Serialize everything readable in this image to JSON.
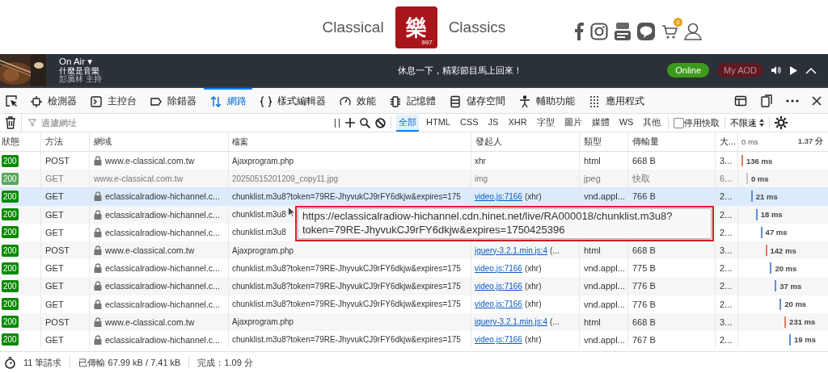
{
  "site_header": {
    "brand_left": "Classical",
    "logo_char": "樂",
    "logo_number": "997",
    "brand_right": "Classics",
    "cart_count": "0"
  },
  "player": {
    "status": "On Air ▾",
    "program": "什麼是音樂",
    "host": "彭廣林 主持",
    "message": "休息一下，精彩節目馬上回來！",
    "online_button": "Online",
    "aod_button": "My AOD"
  },
  "devtools": {
    "tabs": [
      {
        "kind": "inspector",
        "label": "檢測器",
        "selected": false
      },
      {
        "kind": "console",
        "label": "主控台",
        "selected": false
      },
      {
        "kind": "debugger",
        "label": "除錯器",
        "selected": false
      },
      {
        "kind": "network",
        "label": "網路",
        "selected": true
      },
      {
        "kind": "style",
        "label": "樣式編輯器",
        "selected": false
      },
      {
        "kind": "performance",
        "label": "效能",
        "selected": false
      },
      {
        "kind": "memory",
        "label": "記憶體",
        "selected": false
      },
      {
        "kind": "storage",
        "label": "儲存空間",
        "selected": false
      },
      {
        "kind": "accessibility",
        "label": "輔助功能",
        "selected": false
      },
      {
        "kind": "application",
        "label": "應用程式",
        "selected": false
      }
    ]
  },
  "filter": {
    "placeholder": "過濾網址",
    "types": [
      {
        "label": "全部",
        "selected": true
      },
      {
        "label": "HTML",
        "selected": false
      },
      {
        "label": "CSS",
        "selected": false
      },
      {
        "label": "JS",
        "selected": false
      },
      {
        "label": "XHR",
        "selected": false
      },
      {
        "label": "字型",
        "selected": false
      },
      {
        "label": "圖片",
        "selected": false
      },
      {
        "label": "媒體",
        "selected": false
      },
      {
        "label": "WS",
        "selected": false
      },
      {
        "label": "其他",
        "selected": false
      }
    ],
    "disable_cache": {
      "label": "停用快取",
      "checked": false
    },
    "throttle": "不限速"
  },
  "table": {
    "columns": [
      "狀態",
      "方法",
      "網域",
      "檔案",
      "發起人",
      "類型",
      "傳輸量",
      "大..."
    ],
    "timeline_start": "0 ms",
    "timeline_end": "1.37 分",
    "rows": [
      {
        "status": "200",
        "method": "POST",
        "secure": true,
        "cached": false,
        "selected": false,
        "domain": "www.e-classical.com.tw",
        "file": "Ajaxprogram.php",
        "initiator": "xhr",
        "type": "html",
        "transferred": "668 B",
        "size": "3...",
        "duration": "136 ms",
        "color": "#e0815a"
      },
      {
        "status": "200",
        "method": "GET",
        "secure": false,
        "cached": true,
        "selected": false,
        "domain": "www.e-classical.com.tw",
        "file": "20250515201209_copy11.jpg",
        "initiator": "img",
        "type": "jpeg",
        "transferred": "快取",
        "size": "6...",
        "duration": "0 ms",
        "color": "#c8c8c8"
      },
      {
        "status": "200",
        "method": "GET",
        "secure": true,
        "cached": false,
        "selected": true,
        "domain": "eclassicalradiow-hichannel.c...",
        "file": "chunklist.m3u8?token=79RE-JhyvukCJ9rFY6dkjw&expires=175",
        "initiator_link": "video.js:7166",
        "initiator_note": "(xhr)",
        "type": "vnd.appl...",
        "transferred": "766 B",
        "size": "2...",
        "duration": "21 ms",
        "color": "#5b8fd6"
      },
      {
        "status": "200",
        "method": "GET",
        "secure": true,
        "cached": false,
        "selected": false,
        "domain": "eclassicalradiow-hichannel.c...",
        "file": "chunklist.m3u8",
        "size": "2...",
        "duration": "18 ms",
        "color": "#5b8fd6"
      },
      {
        "status": "200",
        "method": "GET",
        "secure": true,
        "cached": false,
        "selected": false,
        "domain": "eclassicalradiow-hichannel.c...",
        "file": "chunklist.m3u8",
        "size": "2...",
        "duration": "47 ms",
        "color": "#5b8fd6"
      },
      {
        "status": "200",
        "method": "POST",
        "secure": true,
        "cached": false,
        "selected": false,
        "domain": "www.e-classical.com.tw",
        "file": "Ajaxprogram.php",
        "initiator_link": "jquery-3.2.1.min.js:4",
        "initiator_note": "(...",
        "type": "html",
        "transferred": "668 B",
        "size": "3...",
        "duration": "142 ms",
        "color": "#e0815a"
      },
      {
        "status": "200",
        "method": "GET",
        "secure": true,
        "cached": false,
        "selected": false,
        "domain": "eclassicalradiow-hichannel.c...",
        "file": "chunklist.m3u8?token=79RE-JhyvukCJ9rFY6dkjw&expires=175",
        "initiator_link": "video.js:7166",
        "initiator_note": "(xhr)",
        "type": "vnd.appl...",
        "transferred": "775 B",
        "size": "2...",
        "duration": "20 ms",
        "color": "#5b8fd6"
      },
      {
        "status": "200",
        "method": "GET",
        "secure": true,
        "cached": false,
        "selected": false,
        "domain": "eclassicalradiow-hichannel.c...",
        "file": "chunklist.m3u8?token=79RE-JhyvukCJ9rFY6dkjw&expires=175",
        "initiator_link": "video.js:7166",
        "initiator_note": "(xhr)",
        "type": "vnd.appl...",
        "transferred": "776 B",
        "size": "2...",
        "duration": "37 ms",
        "color": "#5b8fd6"
      },
      {
        "status": "200",
        "method": "GET",
        "secure": true,
        "cached": false,
        "selected": false,
        "domain": "eclassicalradiow-hichannel.c...",
        "file": "chunklist.m3u8?token=79RE-JhyvukCJ9rFY6dkjw&expires=175",
        "initiator_link": "video.js:7166",
        "initiator_note": "(xhr)",
        "type": "vnd.appl...",
        "transferred": "776 B",
        "size": "2...",
        "duration": "20 ms",
        "color": "#5b8fd6"
      },
      {
        "status": "200",
        "method": "POST",
        "secure": true,
        "cached": false,
        "selected": false,
        "domain": "www.e-classical.com.tw",
        "file": "Ajaxprogram.php",
        "initiator_link": "jquery-3.2.1.min.js:4",
        "initiator_note": "(...",
        "type": "html",
        "transferred": "668 B",
        "size": "3...",
        "duration": "231 ms",
        "color": "#e0815a"
      },
      {
        "status": "200",
        "method": "GET",
        "secure": true,
        "cached": false,
        "selected": false,
        "domain": "eclassicalradiow-hichannel.c...",
        "file": "chunklist.m3u8?token=79RE-JhyvukCJ9rFY6dkjw&expires=175",
        "initiator_link": "video.js:7166",
        "initiator_note": "(xhr)",
        "type": "vnd.appl...",
        "transferred": "767 B",
        "size": "2...",
        "duration": "19 ms",
        "color": "#5b8fd6"
      }
    ]
  },
  "tooltip": {
    "lines": [
      "https://eclassicalradiow-hichannel.cdn.hinet.net/live/RA000018/chunklist.m3u8?",
      "token=79RE-JhyvukCJ9rFY6dkjw&expires=1750425396"
    ]
  },
  "status_bar": {
    "requests": "11 筆請求",
    "transferred": "已傳輸 67.99 kB / 7.41 kB",
    "finished": "完成：1.09 分"
  }
}
